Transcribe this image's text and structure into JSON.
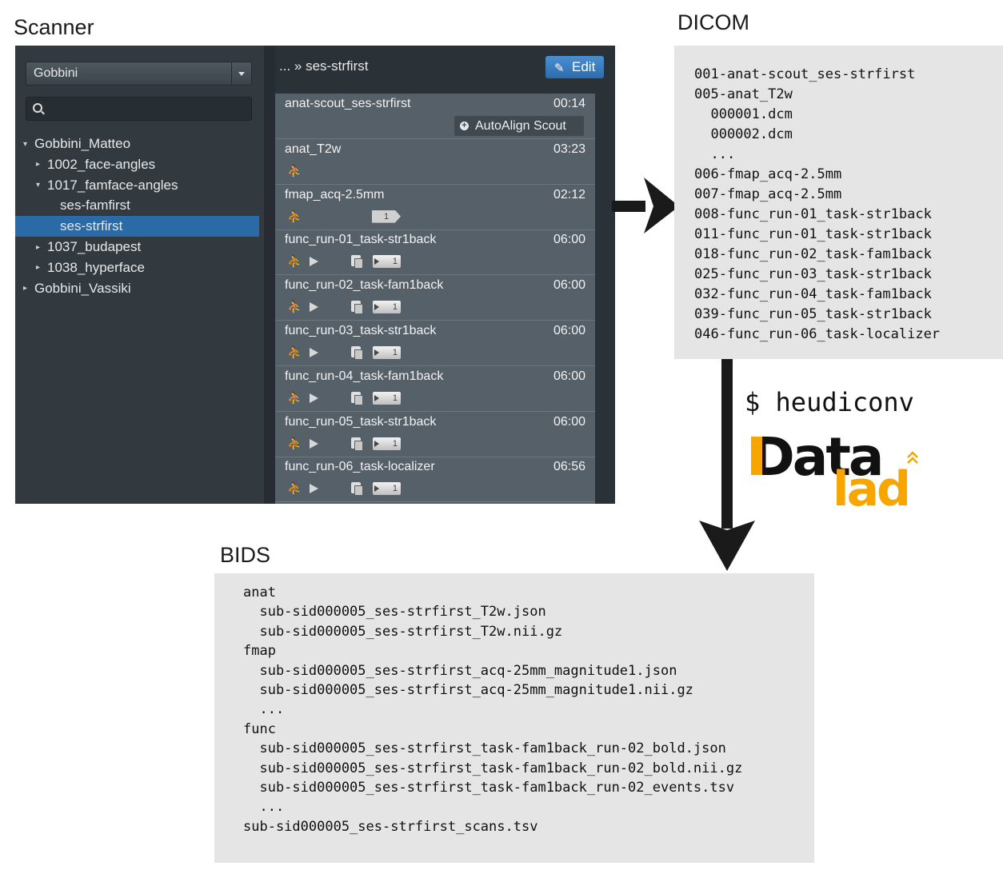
{
  "titles": {
    "scanner": "Scanner",
    "dicom": "DICOM",
    "bids": "BIDS"
  },
  "scanner": {
    "dropdown_value": "Gobbini",
    "search_placeholder": "",
    "tree": [
      {
        "label": "Gobbini_Matteo",
        "toggle": "▾"
      },
      {
        "label": "1002_face-angles",
        "toggle": "▸"
      },
      {
        "label": "1017_famface-angles",
        "toggle": "▾"
      },
      {
        "label": "ses-famfirst",
        "toggle": ""
      },
      {
        "label": "ses-strfirst",
        "toggle": "",
        "selected": true
      },
      {
        "label": "1037_budapest",
        "toggle": "▸"
      },
      {
        "label": "1038_hyperface",
        "toggle": "▸"
      },
      {
        "label": "Gobbini_Vassiki",
        "toggle": "▸"
      }
    ],
    "breadcrumb": "... » ses-strfirst",
    "edit_label": "Edit",
    "autoalign_label": "AutoAlign Scout",
    "badge_count": "1",
    "protocols": [
      {
        "name": "anat-scout_ses-strfirst",
        "time": "00:14"
      },
      {
        "name": "anat_T2w",
        "time": "03:23"
      },
      {
        "name": "fmap_acq-2.5mm",
        "time": "02:12"
      },
      {
        "name": "func_run-01_task-str1back",
        "time": "06:00"
      },
      {
        "name": "func_run-02_task-fam1back",
        "time": "06:00"
      },
      {
        "name": "func_run-03_task-str1back",
        "time": "06:00"
      },
      {
        "name": "func_run-04_task-fam1back",
        "time": "06:00"
      },
      {
        "name": "func_run-05_task-str1back",
        "time": "06:00"
      },
      {
        "name": "func_run-06_task-localizer",
        "time": "06:56"
      }
    ]
  },
  "dicom_lines": [
    "001-anat-scout_ses-strfirst",
    "005-anat_T2w",
    "  000001.dcm",
    "  000002.dcm",
    "  ...",
    "006-fmap_acq-2.5mm",
    "007-fmap_acq-2.5mm",
    "008-func_run-01_task-str1back",
    "011-func_run-01_task-str1back",
    "018-func_run-02_task-fam1back",
    "025-func_run-03_task-str1back",
    "032-func_run-04_task-fam1back",
    "039-func_run-05_task-str1back",
    "046-func_run-06_task-localizer"
  ],
  "command": "$ heudiconv",
  "logo": {
    "word1": "Data",
    "word2": "lad",
    "color_dark": "#111111",
    "color_orange": "#f7a600"
  },
  "bids_lines": [
    "anat",
    "  sub-sid000005_ses-strfirst_T2w.json",
    "  sub-sid000005_ses-strfirst_T2w.nii.gz",
    "fmap",
    "  sub-sid000005_ses-strfirst_acq-25mm_magnitude1.json",
    "  sub-sid000005_ses-strfirst_acq-25mm_magnitude1.nii.gz",
    "  ...",
    "func",
    "  sub-sid000005_ses-strfirst_task-fam1back_run-02_bold.json",
    "  sub-sid000005_ses-strfirst_task-fam1back_run-02_bold.nii.gz",
    "  sub-sid000005_ses-strfirst_task-fam1back_run-02_events.tsv",
    "  ...",
    "sub-sid000005_ses-strfirst_scans.tsv"
  ]
}
